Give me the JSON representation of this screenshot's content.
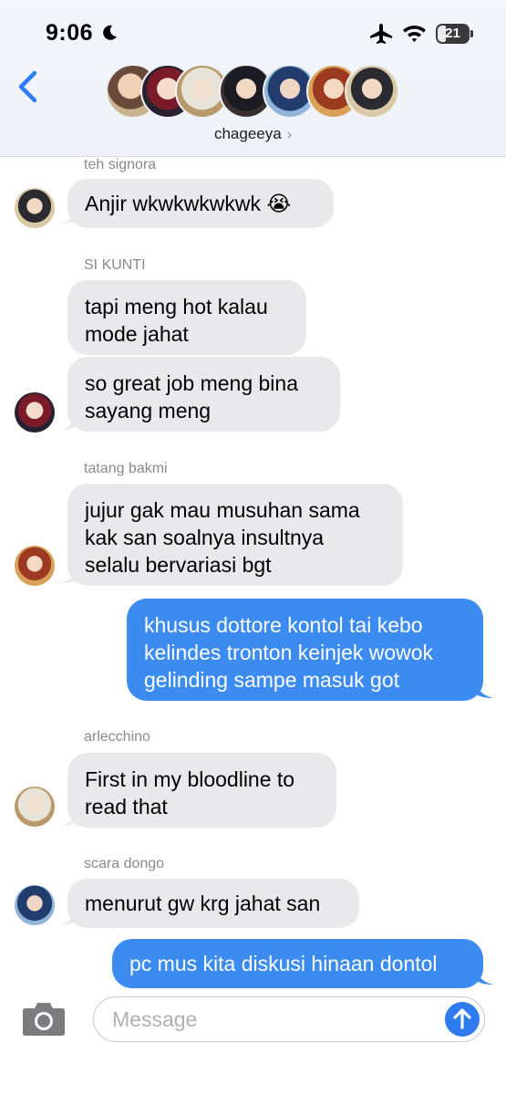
{
  "status_bar": {
    "time": "9:06",
    "battery": "21"
  },
  "header": {
    "group_name": "chageeya",
    "chevron": "›"
  },
  "messages": [
    {
      "sender": "teh signora",
      "text": "Anjir wkwkwkwkwk 😭"
    },
    {
      "sender": "SI KUNTI",
      "text": "tapi meng hot kalau\nmode jahat"
    },
    {
      "text": "so great job meng bina\nsayang meng"
    },
    {
      "sender": "tatang bakmi",
      "text": "jujur gak mau musuhan sama\nkak san soalnya insultnya\nselalu bervariasi bgt"
    },
    {
      "text": "khusus dottore kontol tai kebo\nkelindes tronton keinjek wowok\ngelinding sampe masuk got"
    },
    {
      "sender": "arlecchino",
      "text": "First in my bloodline to\nread that"
    },
    {
      "sender": "scara dongo",
      "text": "menurut gw krg jahat san"
    },
    {
      "text": "pc mus kita diskusi hinaan dontol"
    }
  ],
  "composer": {
    "placeholder": "Message"
  },
  "colors": {
    "accent": "#3b8bf0",
    "incoming_bubble": "#e9e9eb"
  },
  "icons": [
    "moon-icon",
    "airplane-icon",
    "wifi-icon",
    "battery-icon",
    "back-chevron-icon",
    "camera-icon",
    "send-arrow-icon"
  ]
}
